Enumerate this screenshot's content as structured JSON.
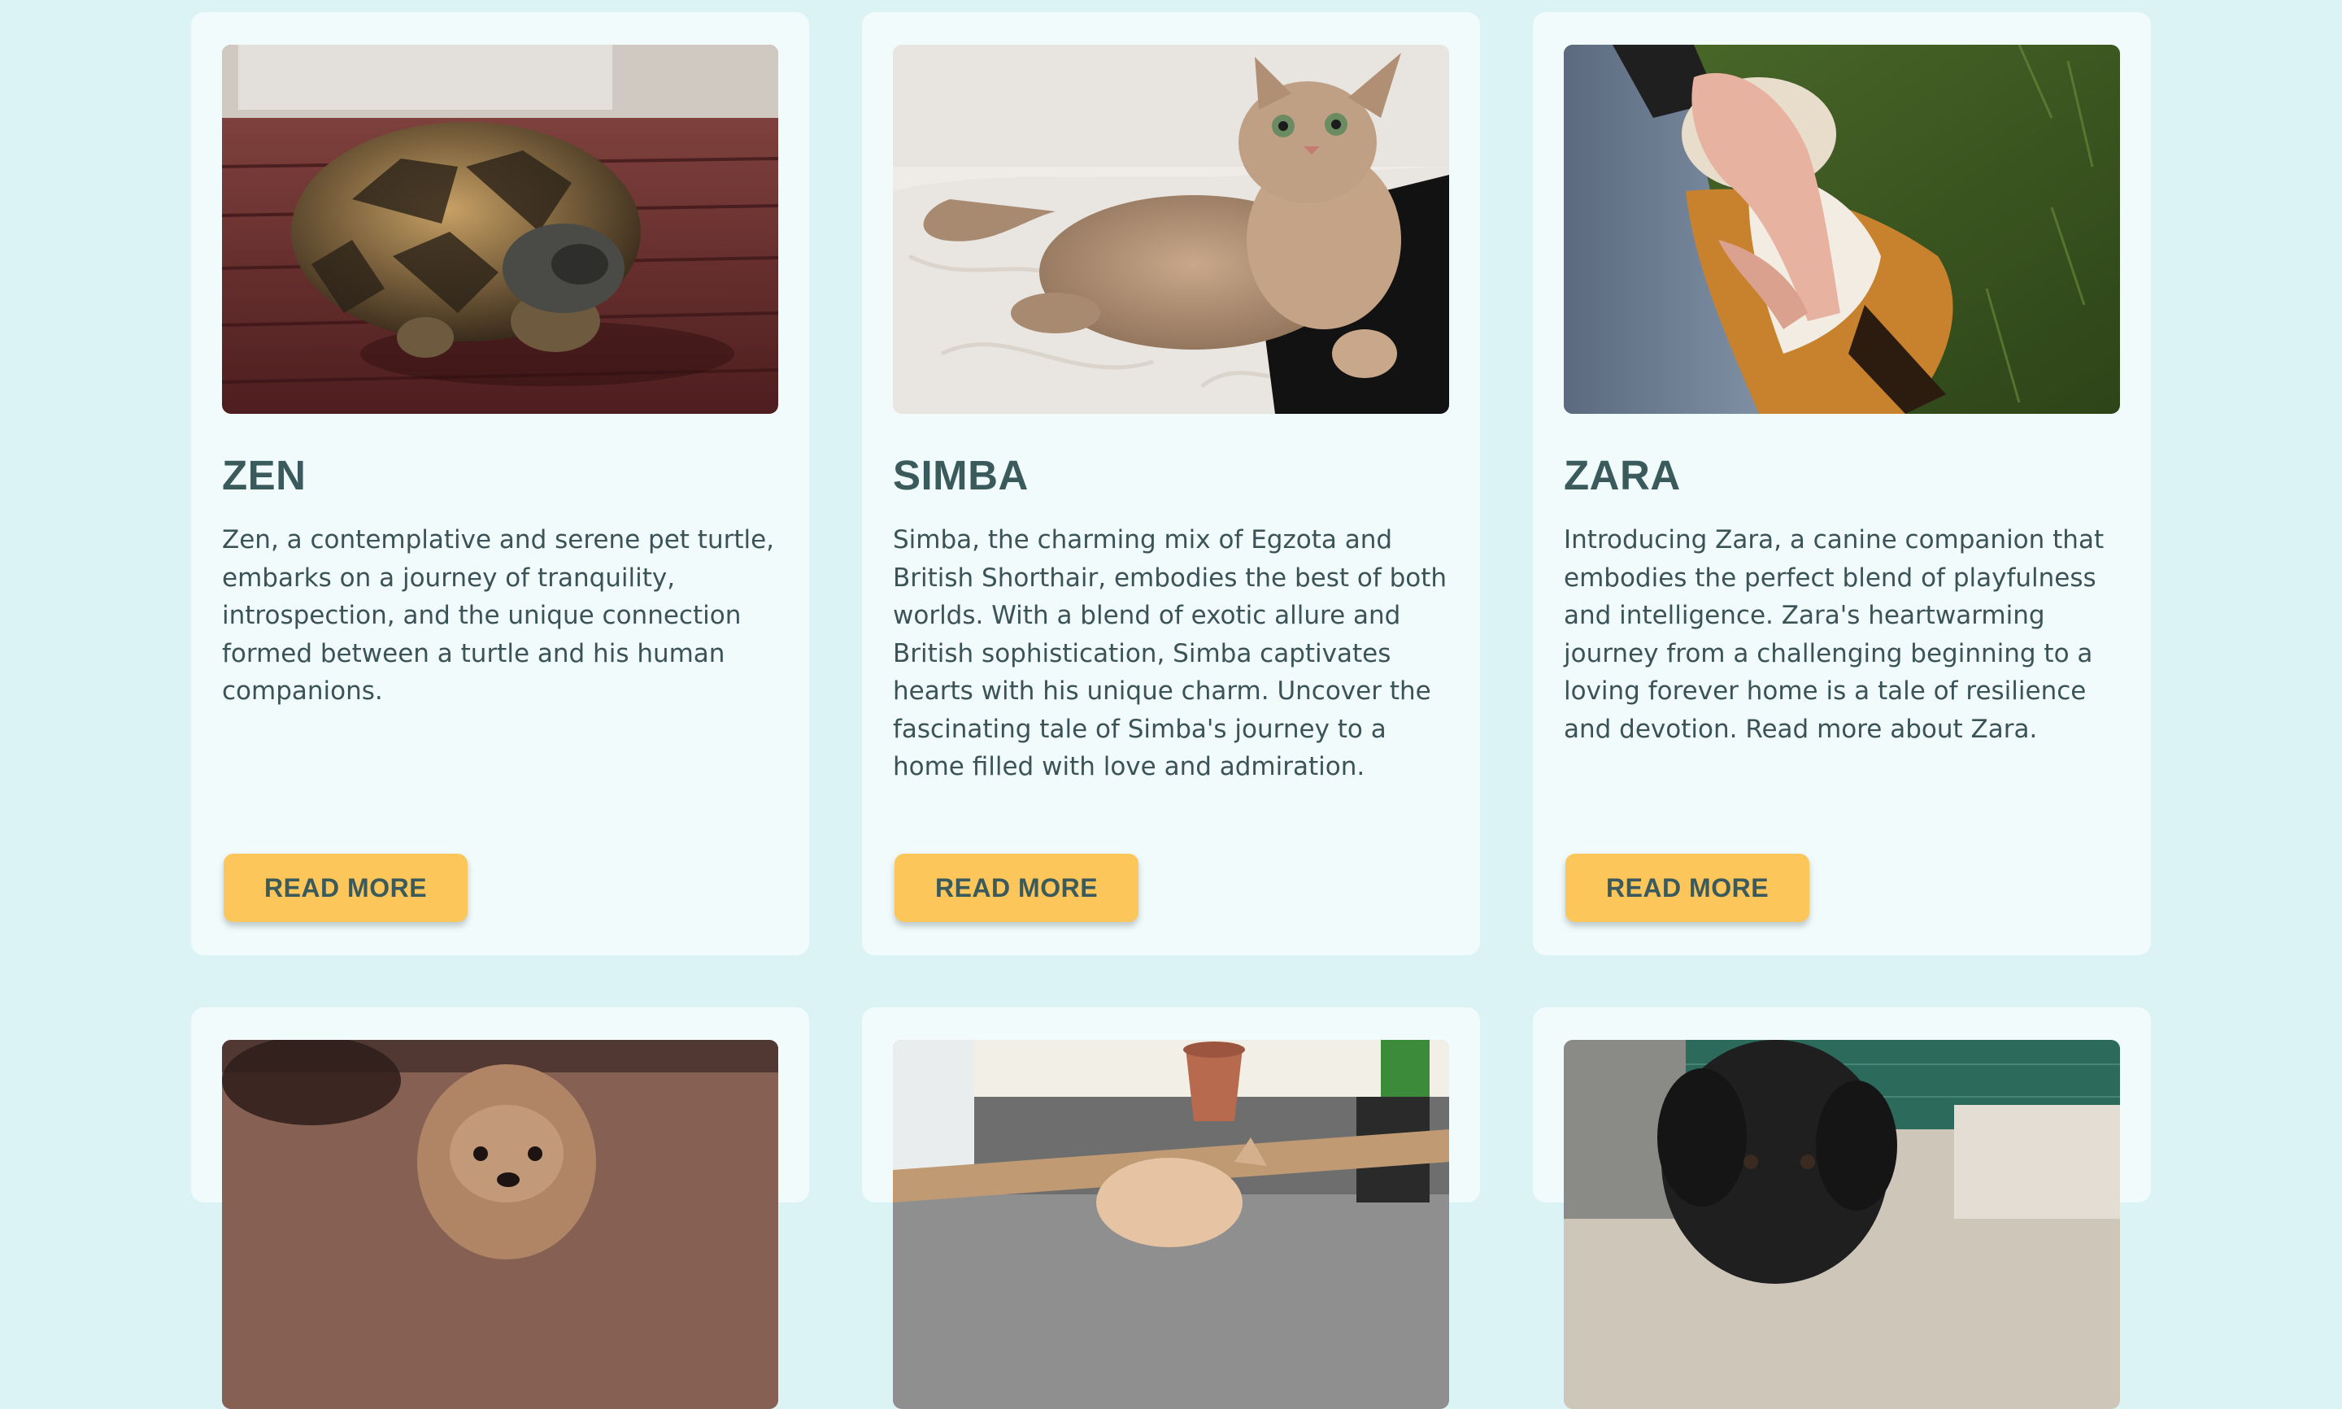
{
  "theme": {
    "background": "#dcf3f5",
    "card": "#f1fbfb",
    "accent": "#fdc65a",
    "heading": "#3b5a5b"
  },
  "pets": [
    {
      "name": "ZEN",
      "description": "Zen, a contemplative and serene pet turtle, embarks on a journey of tranquility, introspection, and the unique connection formed between a turtle and his human companions.",
      "button": "READ MORE",
      "photo": "turtle on wooden deck"
    },
    {
      "name": "SIMBA",
      "description": "Simba, the charming mix of Egzota and British Shorthair, embodies the best of both worlds. With a blend of exotic allure and British sophistication, Simba captivates hearts with his unique charm. Uncover the fascinating tale of Simba's journey to a home filled with love and admiration.",
      "button": "READ MORE",
      "photo": "tabby cat lying on bed"
    },
    {
      "name": "ZARA",
      "description": "Introducing Zara, a canine companion that embodies the perfect blend of playfulness and intelligence. Zara's heartwarming journey from a challenging beginning to a loving forever home is a tale of resilience and devotion. Read more about Zara.",
      "button": "READ MORE",
      "photo": "dog being petted on grass"
    }
  ],
  "more_pets_photos": [
    "fluffy dog on wooden floor",
    "cat in wooden box",
    "black puppy outdoors"
  ]
}
